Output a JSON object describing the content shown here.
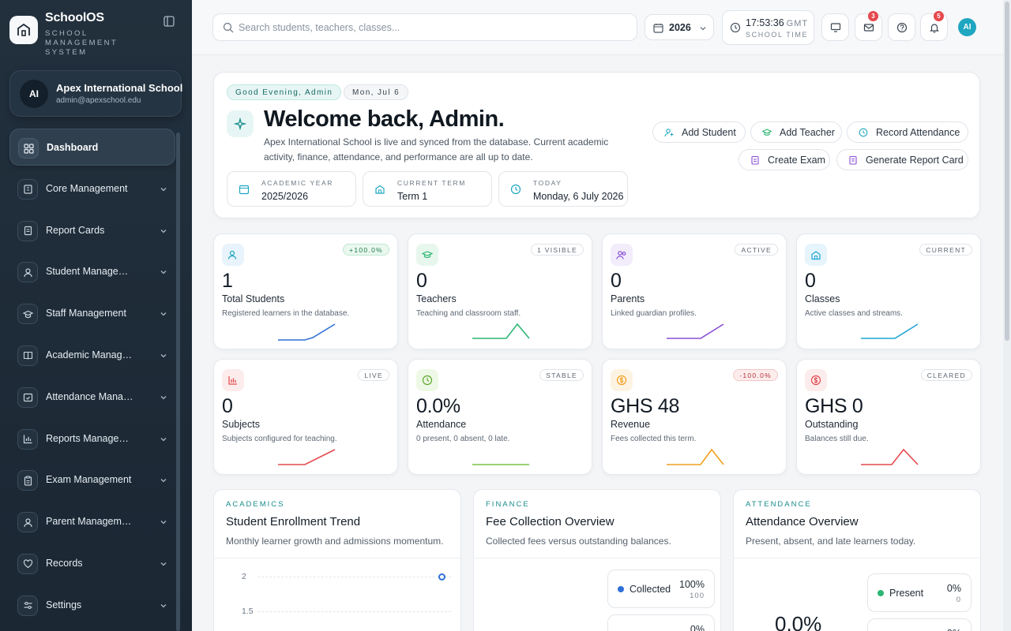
{
  "brand": {
    "name": "SchoolOS",
    "subtitle": "SCHOOL MANAGEMENT SYSTEM"
  },
  "school": {
    "initials": "AI",
    "name": "Apex International School",
    "email": "admin@apexschool.edu"
  },
  "sidebar": {
    "items": [
      {
        "label": "Dashboard",
        "icon": "grid-icon",
        "active": true
      },
      {
        "label": "Core Management",
        "icon": "building-icon"
      },
      {
        "label": "Report Cards",
        "icon": "report-icon"
      },
      {
        "label": "Student Management",
        "icon": "user-icon"
      },
      {
        "label": "Staff Management",
        "icon": "graduation-cap-icon"
      },
      {
        "label": "Academic Management",
        "icon": "book-icon"
      },
      {
        "label": "Attendance Management",
        "icon": "calendar-check-icon"
      },
      {
        "label": "Reports Management",
        "icon": "bar-chart-icon"
      },
      {
        "label": "Exam Management",
        "icon": "clipboard-icon"
      },
      {
        "label": "Parent Management",
        "icon": "user-icon"
      },
      {
        "label": "Records",
        "icon": "heart-shield-icon"
      },
      {
        "label": "Settings",
        "icon": "sliders-icon"
      }
    ]
  },
  "topbar": {
    "search_placeholder": "Search students, teachers, classes...",
    "year": "2026",
    "time": "17:53:36",
    "tz": "GMT",
    "time_label": "SCHOOL TIME",
    "mail_badge": "3",
    "notif_badge": "5",
    "avatar": "AI"
  },
  "welcome": {
    "greeting": "Good Evening, Admin",
    "date_pill": "Mon, Jul 6",
    "title": "Welcome back, Admin.",
    "description": "Apex International School is live and synced from the database. Current academic activity, finance, attendance, and performance are all up to date.",
    "stats": [
      {
        "label": "ACADEMIC YEAR",
        "value": "2025/2026"
      },
      {
        "label": "CURRENT TERM",
        "value": "Term 1"
      },
      {
        "label": "TODAY",
        "value": "Monday, 6 July 2026"
      }
    ],
    "actions": [
      "Add Student",
      "Add Teacher",
      "Record Attendance",
      "Create Exam",
      "Generate Report Card"
    ]
  },
  "kpis": [
    {
      "value": "1",
      "name": "Total Students",
      "desc": "Registered learners in the database.",
      "tag": "+100.0%",
      "color": "#2f6fd6"
    },
    {
      "value": "0",
      "name": "Teachers",
      "desc": "Teaching and classroom staff.",
      "tag": "1 VISIBLE",
      "color": "#2bb673"
    },
    {
      "value": "0",
      "name": "Parents",
      "desc": "Linked guardian profiles.",
      "tag": "ACTIVE",
      "color": "#8a4fd6"
    },
    {
      "value": "0",
      "name": "Classes",
      "desc": "Active classes and streams.",
      "tag": "CURRENT",
      "color": "#1fa6d6"
    },
    {
      "value": "0",
      "name": "Subjects",
      "desc": "Subjects configured for teaching.",
      "tag": "LIVE",
      "color": "#e5484d"
    },
    {
      "value": "0.0%",
      "name": "Attendance",
      "desc": "0 present, 0 absent, 0 late.",
      "tag": "STABLE",
      "color": "#7cc241"
    },
    {
      "value": "GHS 48",
      "name": "Revenue",
      "desc": "Fees collected this term.",
      "tag": "-100.0%",
      "color": "#f0a020"
    },
    {
      "value": "GHS 0",
      "name": "Outstanding",
      "desc": "Balances still due.",
      "tag": "CLEARED",
      "color": "#e5484d"
    }
  ],
  "panels": {
    "enrollment": {
      "eyebrow": "ACADEMICS",
      "title": "Student Enrollment Trend",
      "subtitle": "Monthly learner growth and admissions momentum.",
      "y_ticks": [
        "2",
        "1.5"
      ]
    },
    "fees": {
      "eyebrow": "FINANCE",
      "title": "Fee Collection Overview",
      "subtitle": "Collected fees versus outstanding balances.",
      "collected_label": "Collected",
      "collected_pct": "100%",
      "collected_count": "100",
      "second_pct": "0%"
    },
    "attendance": {
      "eyebrow": "ATTENDANCE",
      "title": "Attendance Overview",
      "subtitle": "Present, absent, and late learners today.",
      "center_value": "0.0%",
      "present_label": "Present",
      "present_pct": "0%",
      "present_count": "0",
      "second_pct": "0%"
    }
  },
  "colors": {
    "accent": "#1fa6c0",
    "sidebar_bg": "#1e2b37",
    "collected": "#2f6fd6",
    "present": "#2bb673"
  }
}
